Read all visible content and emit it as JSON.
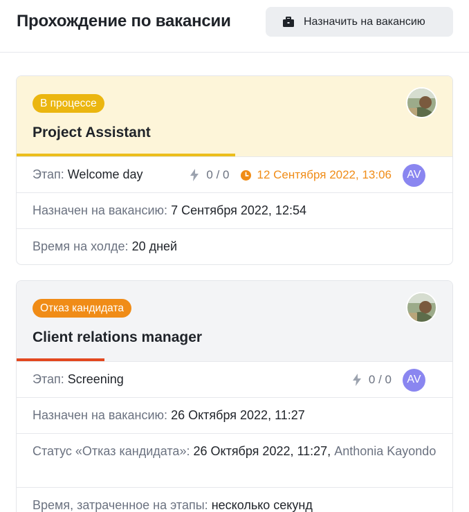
{
  "header": {
    "title": "Прохождение по вакансии",
    "assign_button_label": "Назначить на вакансию",
    "assign_button_icon": "briefcase-icon"
  },
  "colors": {
    "in_progress_badge": "#ebb610",
    "rejected_badge": "#f08c17",
    "in_progress_bar": "#ecbe1b",
    "rejected_bar": "#e3481f",
    "initials_avatar": "#8a86f0",
    "due_date": "#f08c17"
  },
  "cards": [
    {
      "badge": "В процессе",
      "title": "Project Assistant",
      "stage_label": "Этап:",
      "stage_value": "Welcome day",
      "counter": "0 / 0",
      "due": "12 Сентября 2022, 13:06",
      "initials": "AV",
      "assigned_label": "Назначен на вакансию:",
      "assigned_value": "7 Сентября 2022, 12:54",
      "hold_label": "Время на холде:",
      "hold_value": "20 дней"
    },
    {
      "badge": "Отказ кандидата",
      "title": "Client relations manager",
      "stage_label": "Этап:",
      "stage_value": "Screening",
      "counter": "0 / 0",
      "initials": "AV",
      "assigned_label": "Назначен на вакансию:",
      "assigned_value": "26 Октября 2022, 11:27",
      "status_label": "Статус «Отказ кандидата»:",
      "status_value": "26 Октября 2022, 11:27,",
      "status_user": "Anthonia Kayondo",
      "spent_label": "Время, затраченное на этапы:",
      "spent_value": "несколько секунд"
    }
  ]
}
